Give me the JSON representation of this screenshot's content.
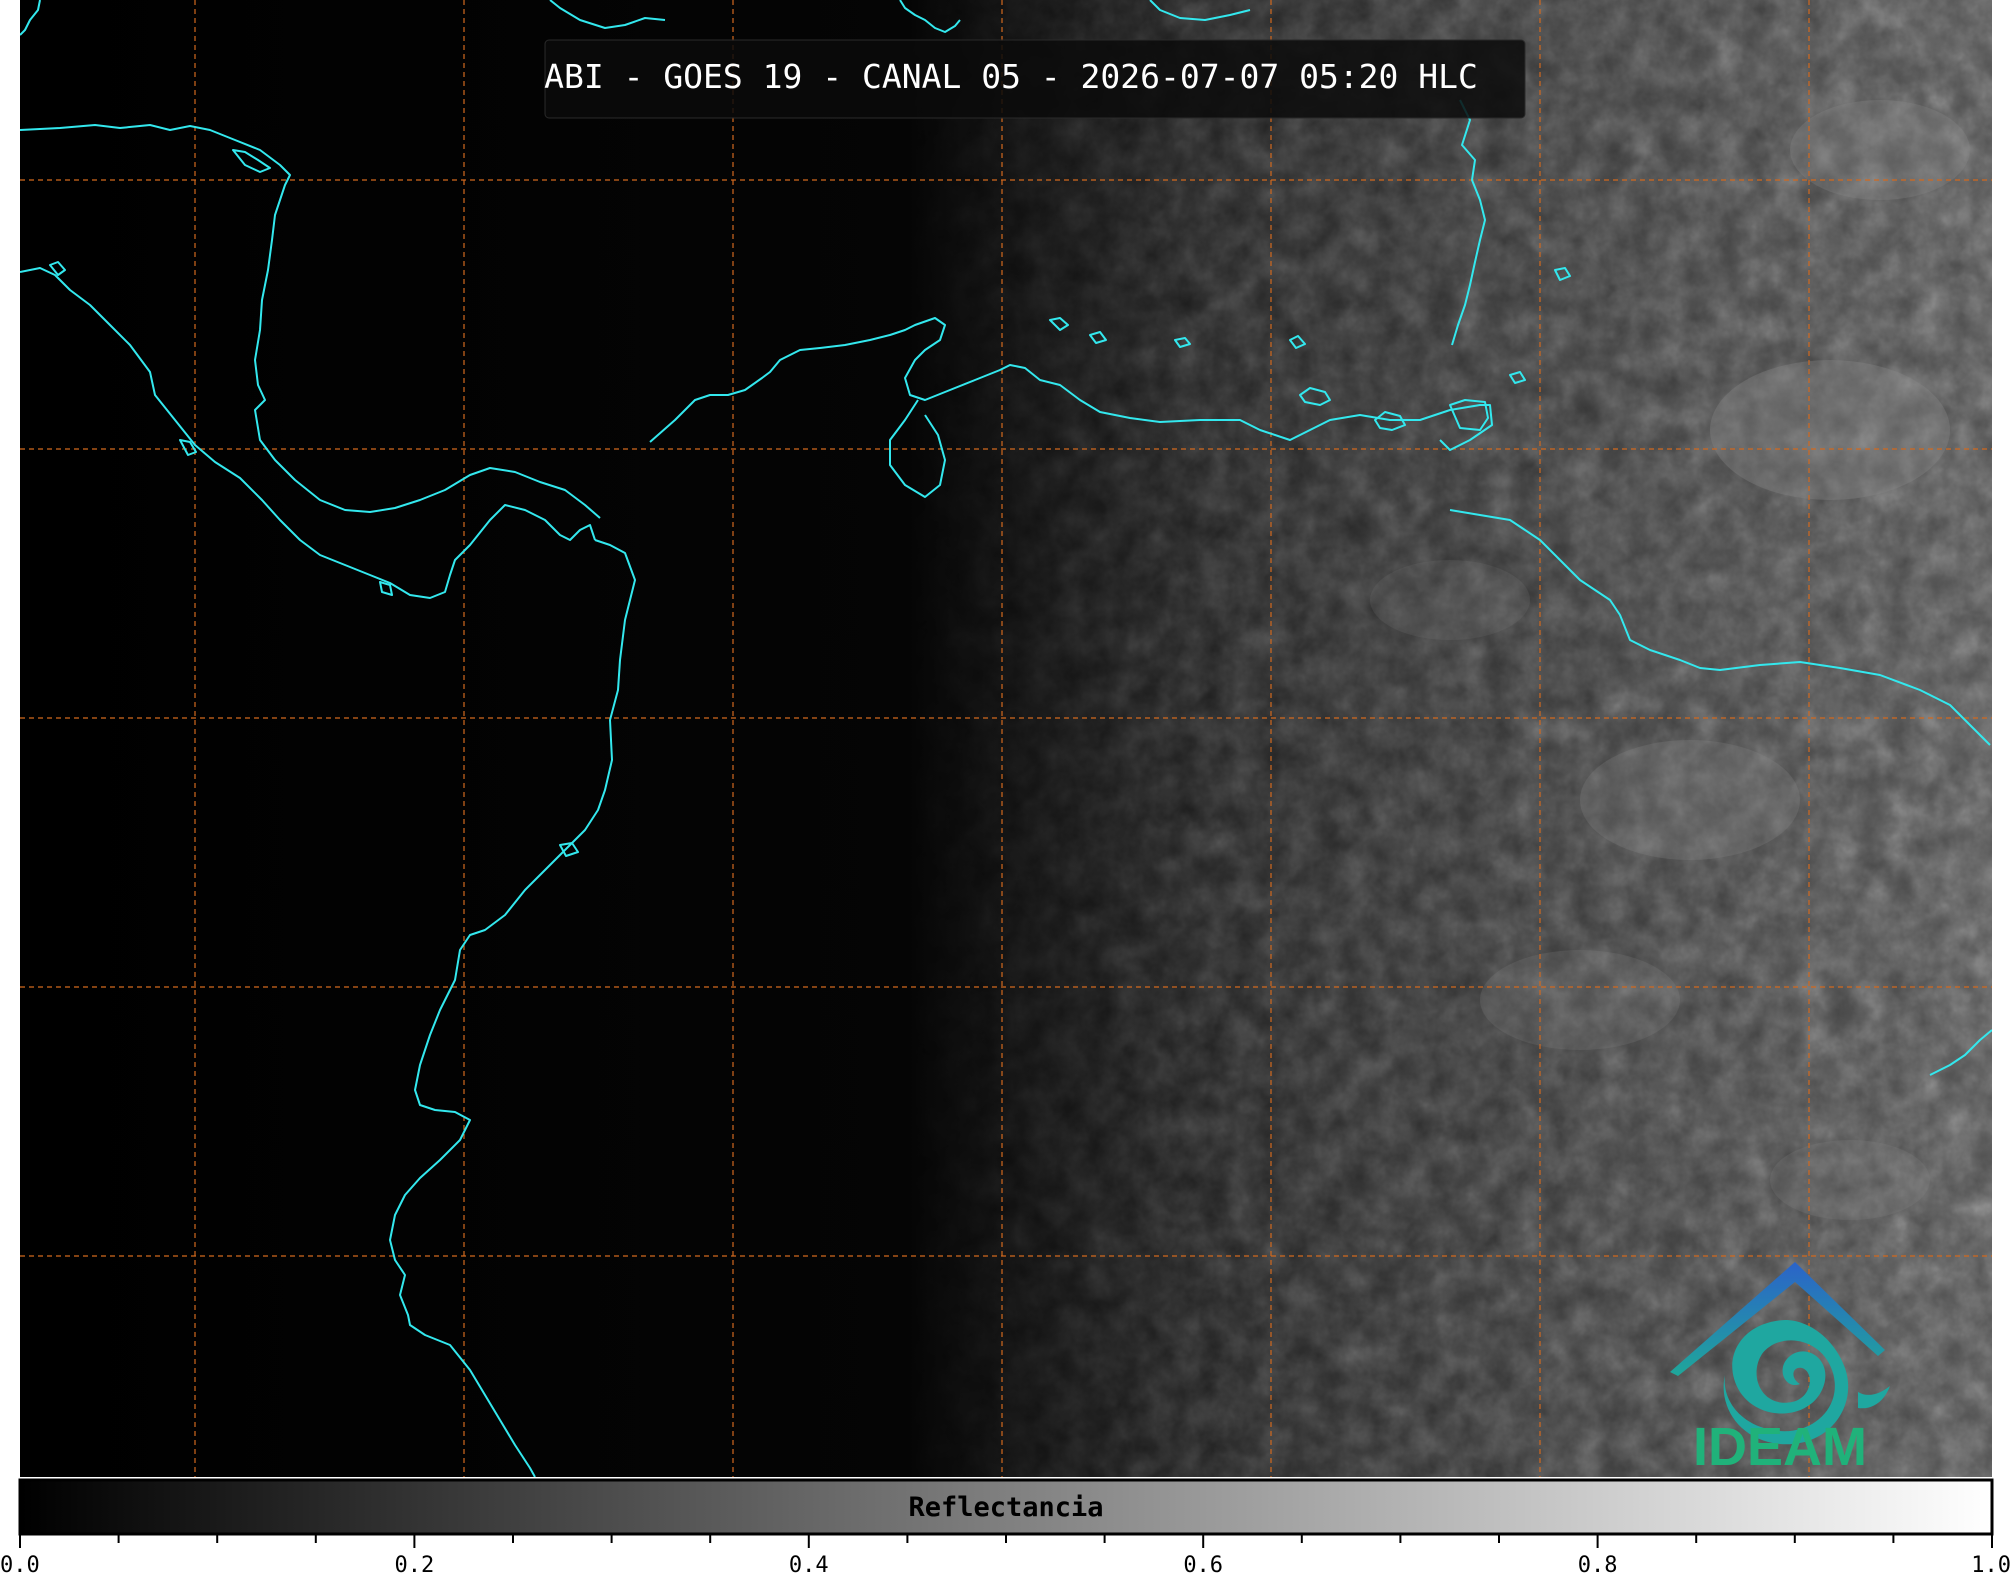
{
  "map": {
    "title": "ABI - GOES 19 - CANAL 05 - 2026-07-07 05:20 HLC",
    "coastline_color": "#33e8ee",
    "grid_color": "#d2691e",
    "background_color": "#000000"
  },
  "logo": {
    "text": "IDEAM",
    "colors": {
      "roof": "#2a86c6",
      "swirl": "#1fa7a0",
      "text": "#20b27a"
    }
  },
  "colorbar": {
    "label": "Reflectancia",
    "min": 0.0,
    "max": 1.0,
    "ticks": [
      "0.0",
      "0.2",
      "0.4",
      "0.6",
      "0.8",
      "1.0"
    ],
    "tick_values": [
      0.0,
      0.2,
      0.4,
      0.6,
      0.8,
      1.0
    ],
    "minor_step": 0.05,
    "colormap": [
      "#000000",
      "#ffffff"
    ]
  }
}
